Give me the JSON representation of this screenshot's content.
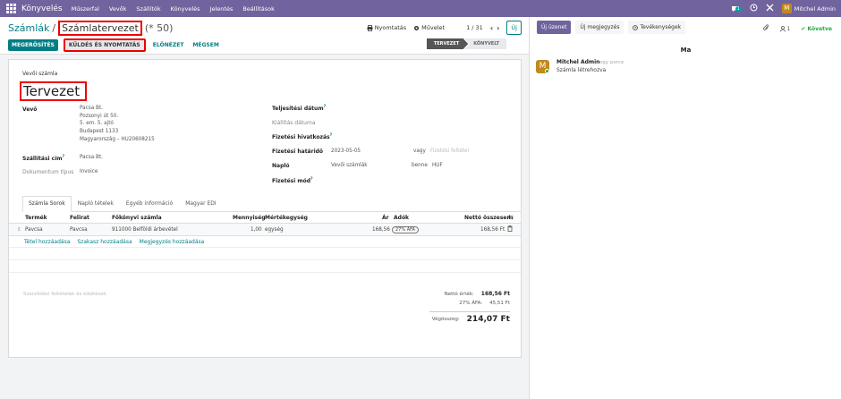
{
  "navbar": {
    "brand": "Könyvelés",
    "menu": [
      "Műszerfal",
      "Vevők",
      "Szállítók",
      "Könyvelés",
      "Jelentés",
      "Beállítások"
    ],
    "chat_badge": "1",
    "user_initial": "M",
    "user_name": "Mitchel Admin"
  },
  "breadcrumb": {
    "parent": "Számlák",
    "current": "Számlatervezet",
    "suffix": "(* 50)"
  },
  "control": {
    "print": "Nyomtatás",
    "action": "Művelet",
    "pager": "1 / 31",
    "new": "Új"
  },
  "actions": {
    "confirm": "MEGERŐSÍTÉS",
    "send_print": "KÜLDÉS ÉS NYOMTATÁS",
    "preview": "ELŐNÉZET",
    "cancel": "MÉGSEM"
  },
  "status": {
    "draft": "TERVEZET",
    "posted": "KÖNYVELT"
  },
  "form": {
    "doc_type": "Vevői számla",
    "name": "Tervezet",
    "customer_label": "Vevő",
    "customer_lines": [
      "Pacsa Bt.",
      "Pozsonyi út 50.",
      "5. em. 5. ajtó",
      "Budapest 1133",
      "Magyarország – HU20608215"
    ],
    "delivery_label": "Szállítási cím",
    "delivery_value": "Pacsa Bt.",
    "doctype_label": "Dokumentum típus",
    "doctype_value": "Invoice",
    "delivery_date_label": "Teljesítési dátum",
    "invoice_date_label": "Kiállítás dátuma",
    "payment_ref_label": "Fizetési hivatkozás",
    "due_label": "Fizetési határidő",
    "due_value": "2023-05-05",
    "or_label": "vagy",
    "terms_placeholder": "Fizetési feltétel",
    "journal_label": "Napló",
    "journal_value": "Vevői számlák",
    "in_label": "benne",
    "currency": "HUF",
    "method_label": "Fizetési mód"
  },
  "tabs": [
    "Számla Sorok",
    "Napló tételek",
    "Egyéb információ",
    "Magyar EDI"
  ],
  "lines": {
    "headers": [
      "Termék",
      "Felirat",
      "Főkönyvi számla",
      "Mennyiség",
      "Mértékegység",
      "Ár",
      "Adók",
      "Nettó összesen"
    ],
    "rows": [
      {
        "product": "Pavcsa",
        "label": "Pavcsa",
        "account": "911000 Belföldi árbevétel",
        "qty": "1,00",
        "uom": "egység",
        "price": "168,56",
        "tax": "27% ÁFA",
        "subtotal": "168,56 Ft"
      }
    ],
    "add_line": "Tétel hozzáadása",
    "add_section": "Szakasz hozzáadása",
    "add_note": "Megjegyzés hozzáadása"
  },
  "terms_placeholder": "Szerződési feltételek és kikötések",
  "totals": {
    "net_label": "Nettó érték:",
    "net_value": "168,56 Ft",
    "vat_label": "27% ÁFA:",
    "vat_value": "45,51 Ft",
    "total_label": "Végösszeg:",
    "total_value": "214,07 Ft"
  },
  "chatter": {
    "send_message": "Új üzenet",
    "log_note": "Új megjegyzés",
    "activities": "Tevékenységek",
    "followers": "1",
    "following": "Követve",
    "day": "Ma",
    "author_initial": "M",
    "author": "Mitchel Admin",
    "time": "egy perce",
    "body": "Számla létrehozva"
  },
  "colors": {
    "navbar": "#71639e",
    "primary": "#017e84",
    "highlight": "#ee0000"
  }
}
